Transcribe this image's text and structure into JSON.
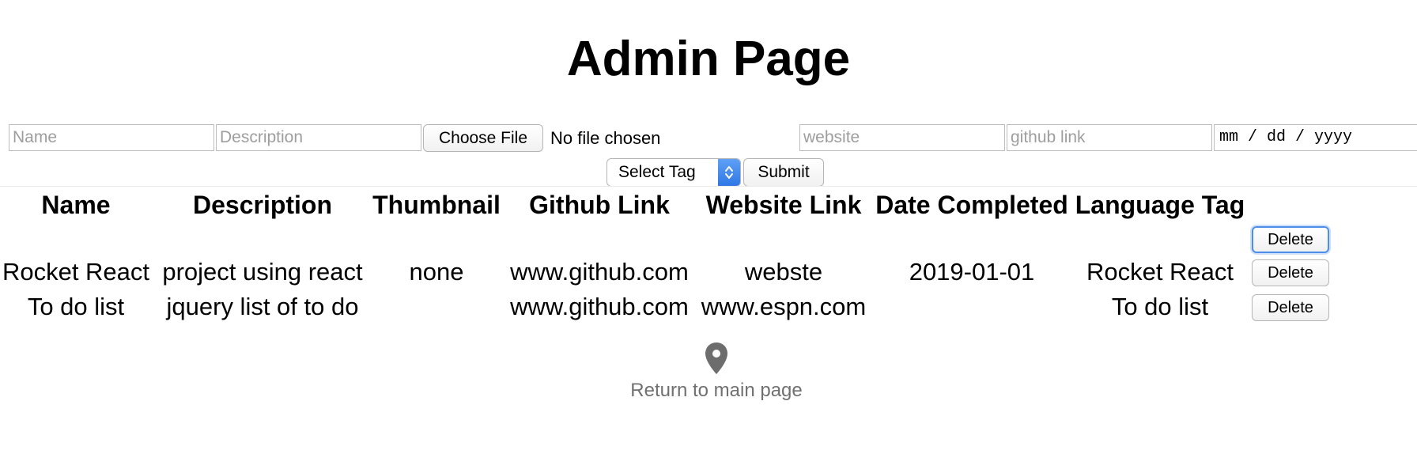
{
  "header": {
    "title": "Admin Page"
  },
  "form": {
    "name_placeholder": "Name",
    "description_placeholder": "Description",
    "choose_file_label": "Choose File",
    "file_status": "No file chosen",
    "website_placeholder": "website",
    "github_placeholder": "github link",
    "date_placeholder": "mm / dd / yyyy",
    "select_tag_label": "Select Tag",
    "submit_label": "Submit",
    "accent_color": "#2f78e6"
  },
  "table": {
    "headers": {
      "name": "Name",
      "description": "Description",
      "thumbnail": "Thumbnail",
      "github": "Github Link",
      "website": "Website Link",
      "date": "Date Completed",
      "language": "Language Tag"
    },
    "delete_label": "Delete",
    "rows": [
      {
        "name": "",
        "description": "",
        "thumbnail": "",
        "github": "",
        "website": "",
        "date": "",
        "language": ""
      },
      {
        "name": "Rocket React",
        "description": "project using react",
        "thumbnail": "none",
        "github": "www.github.com",
        "website": "webste",
        "date": "2019-01-01",
        "language": "Rocket React"
      },
      {
        "name": "To do list",
        "description": "jquery list of to do",
        "thumbnail": "",
        "github": "www.github.com",
        "website": "www.espn.com",
        "date": "",
        "language": "To do list"
      }
    ]
  },
  "footer": {
    "return_label": "Return to main page",
    "icon": "map-pin-icon"
  }
}
